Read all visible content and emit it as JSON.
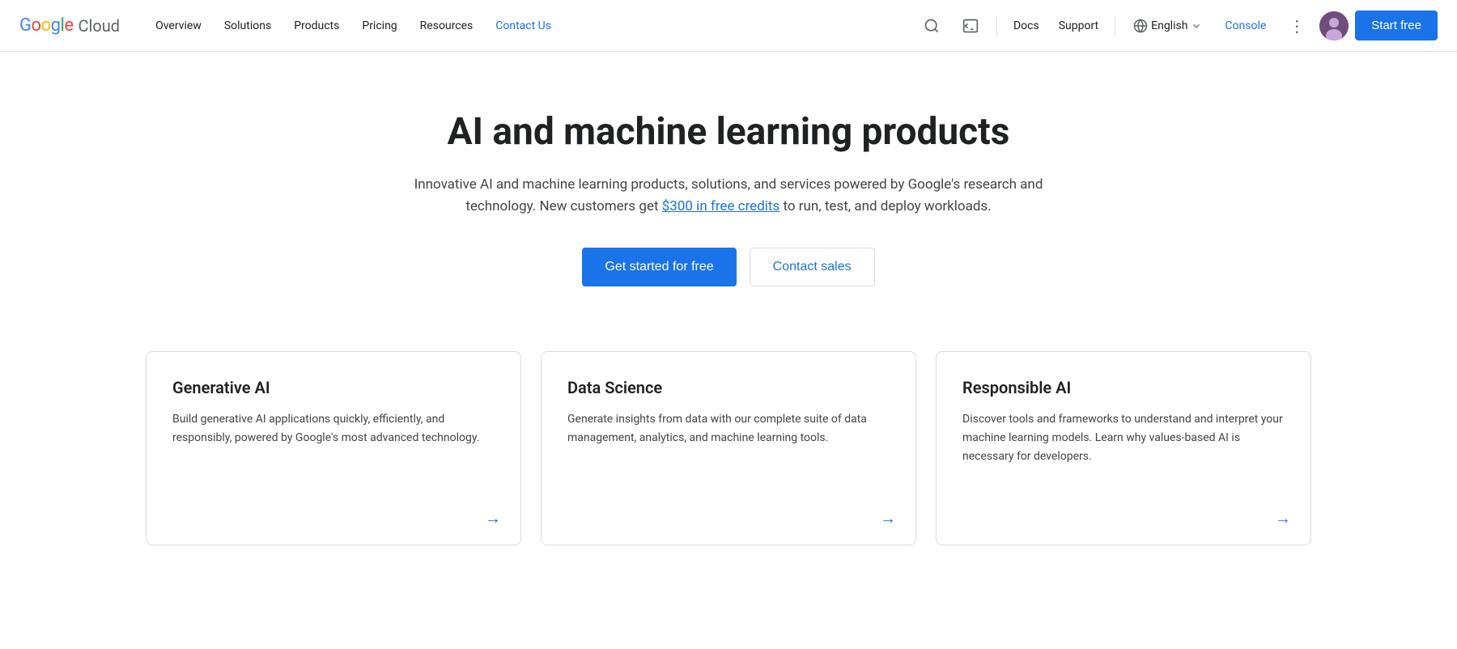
{
  "navbar": {
    "logo_google": "Google",
    "logo_cloud": "Cloud",
    "links": [
      {
        "label": "Overview",
        "active": false
      },
      {
        "label": "Solutions",
        "active": false
      },
      {
        "label": "Products",
        "active": false
      },
      {
        "label": "Pricing",
        "active": false
      },
      {
        "label": "Resources",
        "active": false
      },
      {
        "label": "Contact Us",
        "active": true
      }
    ],
    "docs_label": "Docs",
    "support_label": "Support",
    "language_label": "English",
    "console_label": "Console",
    "start_free_label": "Start free"
  },
  "hero": {
    "title": "AI and machine learning products",
    "subtitle_before": "Innovative AI and machine learning products, solutions, and services powered by Google's research and technology. New customers get ",
    "credits_link": "$300 in free credits",
    "subtitle_after": " to run, test, and deploy workloads.",
    "btn_primary": "Get started for free",
    "btn_secondary": "Contact sales"
  },
  "cards": [
    {
      "title": "Generative AI",
      "desc": "Build generative AI applications quickly, efficiently, and responsibly, powered by Google's most advanced technology.",
      "arrow": "→"
    },
    {
      "title": "Data Science",
      "desc": "Generate insights from data with our complete suite of data management, analytics, and machine learning tools.",
      "arrow": "→"
    },
    {
      "title": "Responsible AI",
      "desc": "Discover tools and frameworks to understand and interpret your machine learning models. Learn why values-based AI is necessary for developers.",
      "arrow": "→"
    }
  ]
}
